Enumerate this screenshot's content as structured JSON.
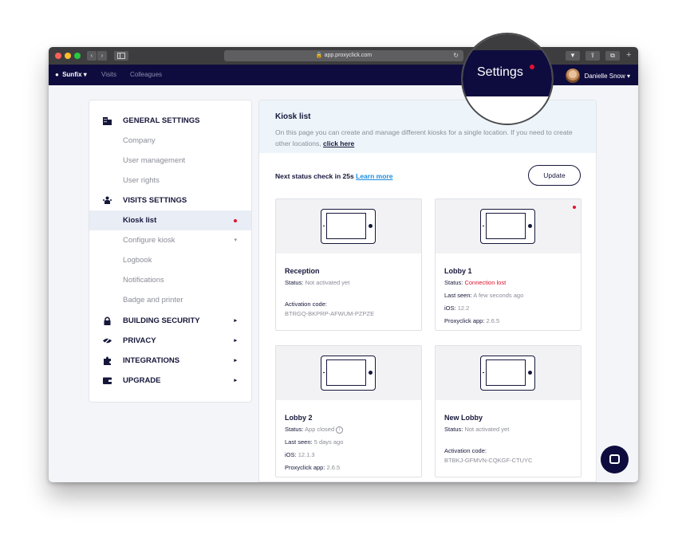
{
  "browser": {
    "url": "app.proxyclick.com",
    "back": "‹",
    "forward": "›"
  },
  "nav": {
    "location": "Sunfix",
    "links": [
      "Visits",
      "Colleagues"
    ],
    "settings": "Settings",
    "user": "Danielle Snow"
  },
  "sidebar": {
    "general": "GENERAL SETTINGS",
    "company": "Company",
    "user_management": "User management",
    "user_rights": "User rights",
    "visits": "VISITS SETTINGS",
    "kiosk_list": "Kiosk list",
    "configure_kiosk": "Configure kiosk",
    "logbook": "Logbook",
    "notifications": "Notifications",
    "badge": "Badge and printer",
    "building": "BUILDING SECURITY",
    "privacy": "PRIVACY",
    "integrations": "INTEGRATIONS",
    "upgrade": "UPGRADE"
  },
  "main": {
    "title": "Kiosk list",
    "desc": "On this page you can create and manage different kiosks for a single location. If you need to create other locations,",
    "desc_link": "click here",
    "status_prefix": "Next status check in 25s",
    "learn_more": "Learn more",
    "update": "Update"
  },
  "kiosks": [
    {
      "name": "Reception",
      "status_label": "Status:",
      "status": "Not activated yet",
      "code_label": "Activation code:",
      "code": "BTRGQ-BKPRP-AFWUM-PZPZE"
    },
    {
      "name": "Lobby 1",
      "status_label": "Status:",
      "status": "Connection lost",
      "last_seen_label": "Last seen:",
      "last_seen": "A few seconds ago",
      "ios_label": "iOS:",
      "ios": "12.2",
      "app_label": "Proxyclick app:",
      "app": "2.6.5"
    },
    {
      "name": "Lobby 2",
      "status_label": "Status:",
      "status": "App closed",
      "last_seen_label": "Last seen:",
      "last_seen": "5 days ago",
      "ios_label": "iOS:",
      "ios": "12.1.3",
      "app_label": "Proxyclick app:",
      "app": "2.6.5"
    },
    {
      "name": "New Lobby",
      "status_label": "Status:",
      "status": "Not activated yet",
      "code_label": "Activation code:",
      "code": "BTBKJ-GFMVN-CQKGF-CTUYC"
    }
  ]
}
